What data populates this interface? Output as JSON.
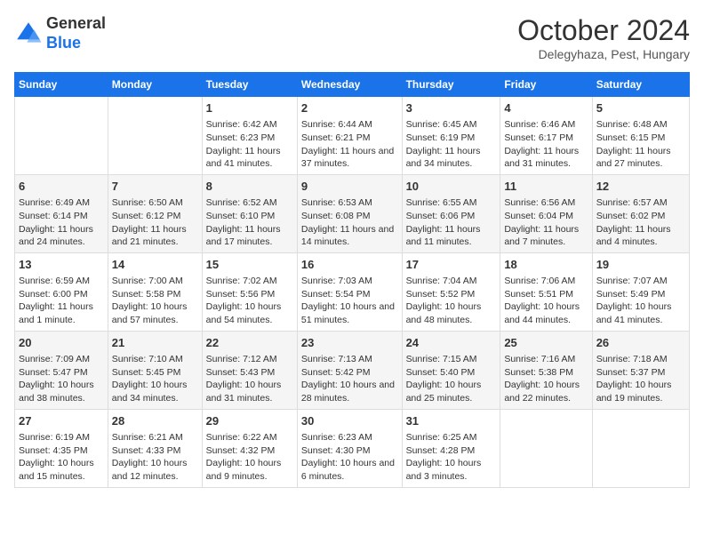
{
  "header": {
    "logo_line1": "General",
    "logo_line2": "Blue",
    "month": "October 2024",
    "location": "Delegyhaza, Pest, Hungary"
  },
  "days_of_week": [
    "Sunday",
    "Monday",
    "Tuesday",
    "Wednesday",
    "Thursday",
    "Friday",
    "Saturday"
  ],
  "weeks": [
    [
      {
        "day": "",
        "content": ""
      },
      {
        "day": "",
        "content": ""
      },
      {
        "day": "1",
        "content": "Sunrise: 6:42 AM\nSunset: 6:23 PM\nDaylight: 11 hours and 41 minutes."
      },
      {
        "day": "2",
        "content": "Sunrise: 6:44 AM\nSunset: 6:21 PM\nDaylight: 11 hours and 37 minutes."
      },
      {
        "day": "3",
        "content": "Sunrise: 6:45 AM\nSunset: 6:19 PM\nDaylight: 11 hours and 34 minutes."
      },
      {
        "day": "4",
        "content": "Sunrise: 6:46 AM\nSunset: 6:17 PM\nDaylight: 11 hours and 31 minutes."
      },
      {
        "day": "5",
        "content": "Sunrise: 6:48 AM\nSunset: 6:15 PM\nDaylight: 11 hours and 27 minutes."
      }
    ],
    [
      {
        "day": "6",
        "content": "Sunrise: 6:49 AM\nSunset: 6:14 PM\nDaylight: 11 hours and 24 minutes."
      },
      {
        "day": "7",
        "content": "Sunrise: 6:50 AM\nSunset: 6:12 PM\nDaylight: 11 hours and 21 minutes."
      },
      {
        "day": "8",
        "content": "Sunrise: 6:52 AM\nSunset: 6:10 PM\nDaylight: 11 hours and 17 minutes."
      },
      {
        "day": "9",
        "content": "Sunrise: 6:53 AM\nSunset: 6:08 PM\nDaylight: 11 hours and 14 minutes."
      },
      {
        "day": "10",
        "content": "Sunrise: 6:55 AM\nSunset: 6:06 PM\nDaylight: 11 hours and 11 minutes."
      },
      {
        "day": "11",
        "content": "Sunrise: 6:56 AM\nSunset: 6:04 PM\nDaylight: 11 hours and 7 minutes."
      },
      {
        "day": "12",
        "content": "Sunrise: 6:57 AM\nSunset: 6:02 PM\nDaylight: 11 hours and 4 minutes."
      }
    ],
    [
      {
        "day": "13",
        "content": "Sunrise: 6:59 AM\nSunset: 6:00 PM\nDaylight: 11 hours and 1 minute."
      },
      {
        "day": "14",
        "content": "Sunrise: 7:00 AM\nSunset: 5:58 PM\nDaylight: 10 hours and 57 minutes."
      },
      {
        "day": "15",
        "content": "Sunrise: 7:02 AM\nSunset: 5:56 PM\nDaylight: 10 hours and 54 minutes."
      },
      {
        "day": "16",
        "content": "Sunrise: 7:03 AM\nSunset: 5:54 PM\nDaylight: 10 hours and 51 minutes."
      },
      {
        "day": "17",
        "content": "Sunrise: 7:04 AM\nSunset: 5:52 PM\nDaylight: 10 hours and 48 minutes."
      },
      {
        "day": "18",
        "content": "Sunrise: 7:06 AM\nSunset: 5:51 PM\nDaylight: 10 hours and 44 minutes."
      },
      {
        "day": "19",
        "content": "Sunrise: 7:07 AM\nSunset: 5:49 PM\nDaylight: 10 hours and 41 minutes."
      }
    ],
    [
      {
        "day": "20",
        "content": "Sunrise: 7:09 AM\nSunset: 5:47 PM\nDaylight: 10 hours and 38 minutes."
      },
      {
        "day": "21",
        "content": "Sunrise: 7:10 AM\nSunset: 5:45 PM\nDaylight: 10 hours and 34 minutes."
      },
      {
        "day": "22",
        "content": "Sunrise: 7:12 AM\nSunset: 5:43 PM\nDaylight: 10 hours and 31 minutes."
      },
      {
        "day": "23",
        "content": "Sunrise: 7:13 AM\nSunset: 5:42 PM\nDaylight: 10 hours and 28 minutes."
      },
      {
        "day": "24",
        "content": "Sunrise: 7:15 AM\nSunset: 5:40 PM\nDaylight: 10 hours and 25 minutes."
      },
      {
        "day": "25",
        "content": "Sunrise: 7:16 AM\nSunset: 5:38 PM\nDaylight: 10 hours and 22 minutes."
      },
      {
        "day": "26",
        "content": "Sunrise: 7:18 AM\nSunset: 5:37 PM\nDaylight: 10 hours and 19 minutes."
      }
    ],
    [
      {
        "day": "27",
        "content": "Sunrise: 6:19 AM\nSunset: 4:35 PM\nDaylight: 10 hours and 15 minutes."
      },
      {
        "day": "28",
        "content": "Sunrise: 6:21 AM\nSunset: 4:33 PM\nDaylight: 10 hours and 12 minutes."
      },
      {
        "day": "29",
        "content": "Sunrise: 6:22 AM\nSunset: 4:32 PM\nDaylight: 10 hours and 9 minutes."
      },
      {
        "day": "30",
        "content": "Sunrise: 6:23 AM\nSunset: 4:30 PM\nDaylight: 10 hours and 6 minutes."
      },
      {
        "day": "31",
        "content": "Sunrise: 6:25 AM\nSunset: 4:28 PM\nDaylight: 10 hours and 3 minutes."
      },
      {
        "day": "",
        "content": ""
      },
      {
        "day": "",
        "content": ""
      }
    ]
  ]
}
